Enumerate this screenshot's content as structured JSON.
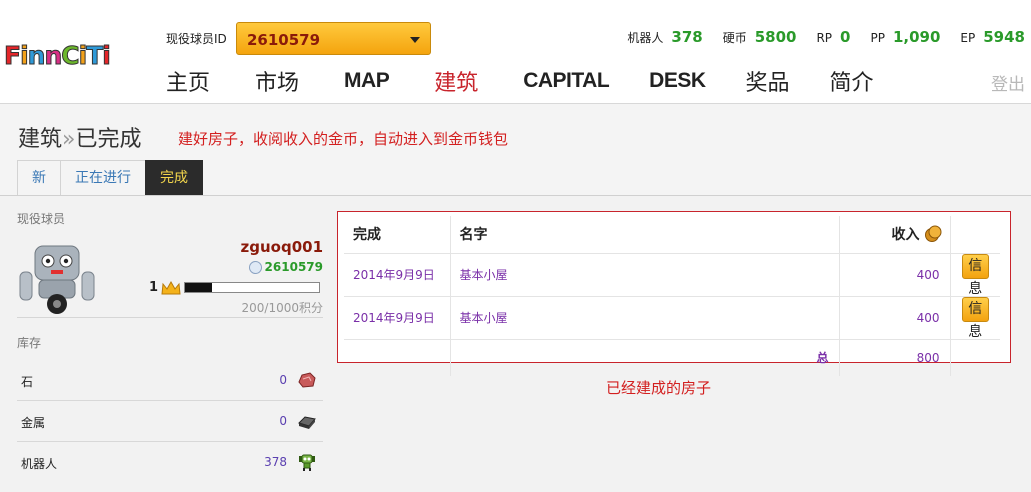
{
  "header": {
    "logo_letters": [
      "F",
      "i",
      "n",
      "n",
      "C",
      "i",
      "T",
      "i"
    ],
    "logo_colors": [
      "#e4262a",
      "#f2a11a",
      "#2f9ad8",
      "#d92f85",
      "#6cb82c",
      "#f2a11a",
      "#2f9ad8",
      "#e4262a"
    ],
    "player_label": "现役球员ID",
    "player_id": "2610579",
    "stats": [
      {
        "label": "机器人",
        "value": "378"
      },
      {
        "label": "硬币",
        "value": "5800"
      },
      {
        "label": "RP",
        "value": "0"
      },
      {
        "label": "PP",
        "value": "1,090"
      },
      {
        "label": "EP",
        "value": "5948"
      }
    ],
    "nav": [
      {
        "label": "主页",
        "latin": false,
        "active": false
      },
      {
        "label": "市场",
        "latin": false,
        "active": false
      },
      {
        "label": "MAP",
        "latin": true,
        "active": false
      },
      {
        "label": "建筑",
        "latin": false,
        "active": true
      },
      {
        "label": "CAPITAL",
        "latin": true,
        "active": false
      },
      {
        "label": "DESK",
        "latin": true,
        "active": false
      },
      {
        "label": "奖品",
        "latin": false,
        "active": false
      },
      {
        "label": "简介",
        "latin": false,
        "active": false
      }
    ],
    "logout": "登出"
  },
  "page": {
    "title_part1": "建筑",
    "title_sep": "»",
    "title_part2": "已完成",
    "note": "建好房子，收阅收入的金币，自动进入到金币钱包",
    "tabs": [
      {
        "label": "新",
        "active": false
      },
      {
        "label": "正在进行",
        "active": false
      },
      {
        "label": "完成",
        "active": true
      }
    ]
  },
  "sidebar": {
    "section_title": "现役球员",
    "username": "zguoq001",
    "user_id": "2610579",
    "level": "1",
    "xp_fraction": 0.2,
    "xp_text": "200/1000积分",
    "inventory_title": "库存",
    "inventory": [
      {
        "name": "石",
        "count": "0",
        "icon": "stone-icon"
      },
      {
        "name": "金属",
        "count": "0",
        "icon": "metal-icon"
      },
      {
        "name": "机器人",
        "count": "378",
        "icon": "robot-icon"
      }
    ]
  },
  "table": {
    "headers": {
      "date": "完成",
      "name": "名字",
      "income": "收入"
    },
    "rows": [
      {
        "date": "2014年9月9日",
        "name": "基本小屋",
        "income": "400",
        "action": "信息"
      },
      {
        "date": "2014年9月9日",
        "name": "基本小屋",
        "income": "400",
        "action": "信息"
      }
    ],
    "total_label": "总",
    "total_value": "800"
  },
  "caption": "已经建成的房子"
}
